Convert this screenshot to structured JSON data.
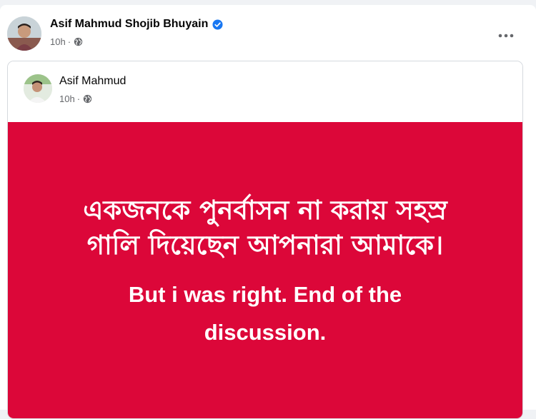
{
  "post": {
    "author": "Asif Mahmud Shojib Bhuyain",
    "verified_icon": "verified-badge-icon",
    "time": "10h",
    "separator": "·",
    "audience_icon": "globe-icon",
    "more_icon": "more-options-icon"
  },
  "shared_post": {
    "author": "Asif Mahmud",
    "time": "10h",
    "separator": "·",
    "audience_icon": "globe-icon",
    "content": {
      "background_color": "#dc0739",
      "text_color": "#ffffff",
      "bangla_lines": [
        "একজনকে পুনর্বাসন না করায় সহস্র",
        "গালি দিয়েছেন আপনারা আমাকে।"
      ],
      "english_lines": [
        "But i was right. End of the",
        "discussion."
      ]
    }
  },
  "colors": {
    "verified_blue": "#1877f2",
    "meta_gray": "#65676b",
    "name_black": "#050505"
  }
}
